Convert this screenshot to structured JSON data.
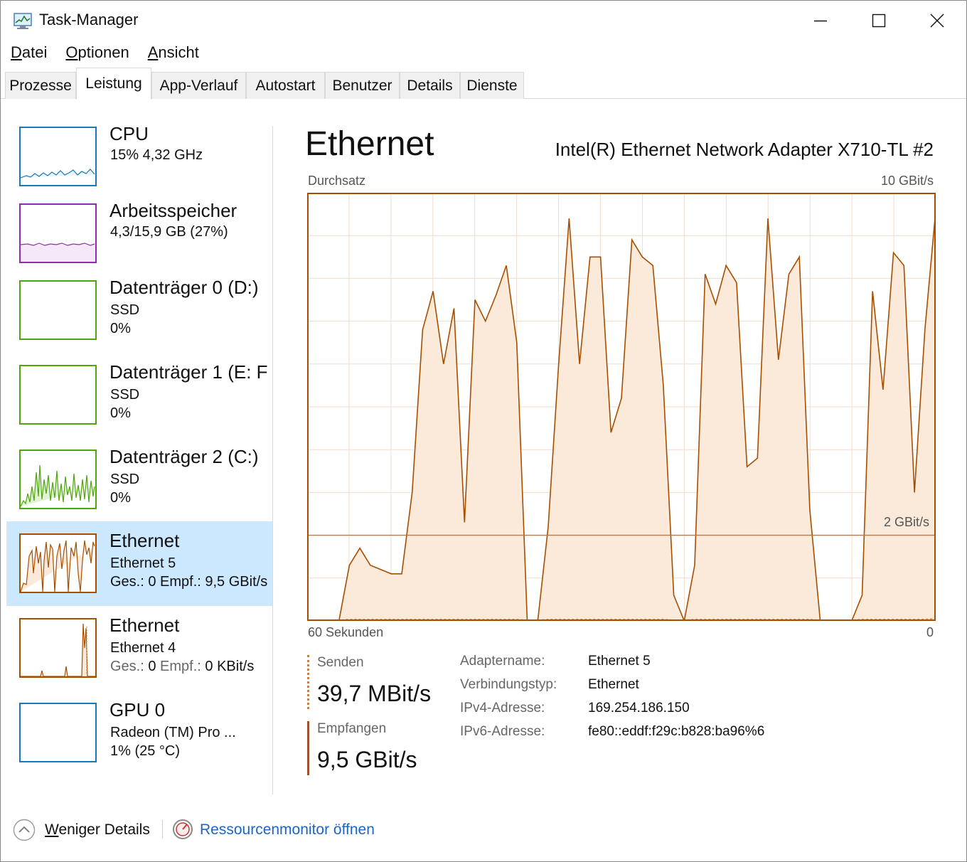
{
  "window": {
    "title": "Task-Manager",
    "icon": "task-manager-icon",
    "controls": [
      "minimize-icon",
      "maximize-icon",
      "close-icon"
    ]
  },
  "menu": [
    {
      "label": "Datei",
      "ul": "D",
      "rest": "atei"
    },
    {
      "label": "Optionen",
      "ul": "O",
      "rest": "ptionen"
    },
    {
      "label": "Ansicht",
      "ul": "A",
      "rest": "nsicht"
    }
  ],
  "tabs": [
    "Prozesse",
    "Leistung",
    "App-Verlauf",
    "Autostart",
    "Benutzer",
    "Details",
    "Dienste"
  ],
  "active_tab": "Leistung",
  "sidebar": [
    {
      "name": "CPU",
      "line2": "15% 4,32 GHz",
      "line3": "",
      "color": "#1779ba"
    },
    {
      "name": "Arbeitsspeicher",
      "line2": "4,3/15,9 GB (27%)",
      "line3": "",
      "color": "#8b2dad"
    },
    {
      "name": "Datenträger 0 (D:)",
      "line2": "SSD",
      "line3": "0%",
      "color": "#4da60c"
    },
    {
      "name": "Datenträger 1 (E: F",
      "line2": "SSD",
      "line3": "0%",
      "color": "#4da60c"
    },
    {
      "name": "Datenträger 2 (C:)",
      "line2": "SSD",
      "line3": "0%",
      "color": "#4da60c"
    },
    {
      "name": "Ethernet",
      "line2": "Ethernet 5",
      "line3": "Ges.: 0 Empf.: 9,5 GBit/s",
      "color": "#a74f01"
    },
    {
      "name": "Ethernet",
      "line2": "Ethernet 4",
      "line3_parts": [
        "Ges.:",
        " 0 ",
        "Empf.:",
        " 0 KBit/s"
      ],
      "color": "#a74f01"
    },
    {
      "name": "GPU 0",
      "line2": "Radeon (TM) Pro ...",
      "line3": "1% (25 °C)",
      "color": "#1779ba"
    }
  ],
  "selected_index": 5,
  "detail": {
    "title": "Ethernet",
    "adapter_model": "Intel(R) Ethernet Network Adapter X710-TL #2",
    "graph_label": "Durchsatz",
    "graph_max": "10 GBit/s",
    "graph_mid": "2 GBit/s",
    "time_span": "60 Sekunden",
    "time_end": "0",
    "send_label": "Senden",
    "send_value": "39,7 MBit/s",
    "recv_label": "Empfangen",
    "recv_value": "9,5 GBit/s",
    "properties": [
      {
        "key": "Adaptername:",
        "value": "Ethernet 5"
      },
      {
        "key": "Verbindungstyp:",
        "value": "Ethernet"
      },
      {
        "key": "IPv4-Adresse:",
        "value": "169.254.186.150"
      },
      {
        "key": "IPv6-Adresse:",
        "value": "fe80::eddf:f29c:b828:ba96%6"
      }
    ]
  },
  "footer": {
    "fewer_details": "Weniger Details",
    "fewer_ul": "W",
    "fewer_rest": "eniger Details",
    "resource_monitor": "Ressourcenmonitor öffnen"
  },
  "chart_data": {
    "type": "line",
    "title": "",
    "ylabel": "Durchsatz",
    "xlabel": "60 Sekunden",
    "ylim_gbit": [
      0,
      10
    ],
    "reference_line_gbit": 2,
    "x_seconds_ago": [
      60,
      59,
      58,
      57,
      56,
      55,
      54,
      53,
      52,
      51,
      50,
      49,
      48,
      47,
      46,
      45,
      44,
      43,
      42,
      41,
      40,
      39,
      38,
      37,
      36,
      35,
      34,
      33,
      32,
      31,
      30,
      29,
      28,
      27,
      26,
      25,
      24,
      23,
      22,
      21,
      20,
      19,
      18,
      17,
      16,
      15,
      14,
      13,
      12,
      11,
      10,
      9,
      8,
      7,
      6,
      5,
      4,
      3,
      2,
      1,
      0
    ],
    "series": [
      {
        "values": [
          0,
          0,
          0,
          0,
          1.3,
          1.7,
          1.3,
          1.2,
          1.1,
          1.1,
          3.0,
          6.8,
          7.7,
          6.0,
          7.3,
          2.3,
          7.5,
          7.0,
          7.6,
          8.3,
          6.5,
          0,
          0,
          2.2,
          6.0,
          9.4,
          6.0,
          8.5,
          8.5,
          4.4,
          5.2,
          8.9,
          8.5,
          8.3,
          5.5,
          0.6,
          0,
          1.3,
          8.1,
          7.4,
          8.3,
          7.9,
          3.6,
          3.8,
          9.4,
          6.1,
          8.1,
          8.5,
          2.6,
          0,
          0,
          0,
          0,
          0.6,
          7.7,
          5.4,
          8.6,
          8.3,
          3.0,
          6.8,
          9.5
        ]
      },
      {
        "values": [
          0,
          0,
          0,
          0,
          0.02,
          0.02,
          0.02,
          0.02,
          0.02,
          0.02,
          0.02,
          0.02,
          0.02,
          0.02,
          0.02,
          0.02,
          0.02,
          0.02,
          0.02,
          0.02,
          0.02,
          0,
          0,
          0.02,
          0.02,
          0.02,
          0.02,
          0.02,
          0.02,
          0.02,
          0.02,
          0.02,
          0.02,
          0.02,
          0.02,
          0,
          0,
          0.02,
          0.02,
          0.02,
          0.02,
          0.02,
          0.02,
          0.02,
          0.02,
          0.02,
          0.02,
          0.02,
          0.02,
          0,
          0,
          0,
          0,
          0.02,
          0.02,
          0.02,
          0.02,
          0.02,
          0.02,
          0.02,
          0.04
        ]
      }
    ]
  }
}
